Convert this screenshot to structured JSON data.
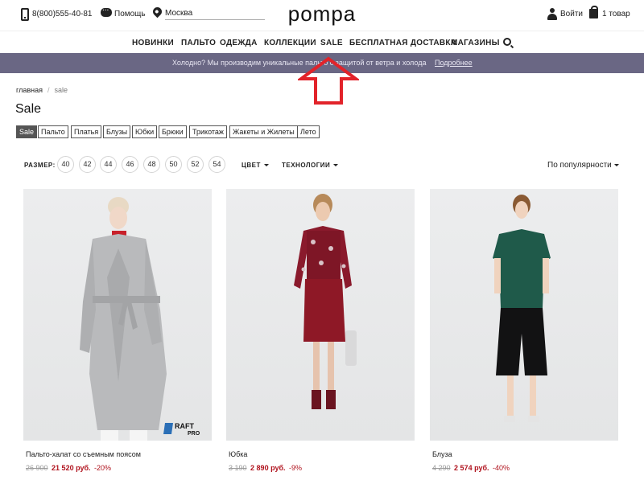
{
  "header": {
    "phone": "8(800)555-40-81",
    "help": "Помощь",
    "city": "Москва",
    "logo": "pompa",
    "login": "Войти",
    "cart": "1 товар"
  },
  "nav": {
    "items": [
      "НОВИНКИ",
      "ПАЛЬТО",
      "ОДЕЖДА",
      "КОЛЛЕКЦИИ",
      "SALE",
      "БЕСПЛАТНАЯ ДОСТАВКА",
      "МАГАЗИНЫ"
    ]
  },
  "promo": {
    "text": "Холодно? Мы производим уникальные пальто с защитой от ветра и холода",
    "link": "Подробнее",
    "color": "#6a6784"
  },
  "breadcrumb": {
    "home": "главная",
    "sep": "/",
    "current": "sale"
  },
  "page": {
    "title": "Sale"
  },
  "categories": [
    "Sale",
    "Пальто",
    "Платья",
    "Блузы",
    "Юбки",
    "Брюки",
    "Трикотаж",
    "Жакеты и Жилеты",
    "Лето"
  ],
  "filters": {
    "size_label": "РАЗМЕР:",
    "sizes": [
      "40",
      "42",
      "44",
      "46",
      "48",
      "50",
      "52",
      "54"
    ],
    "color": "ЦВЕТ",
    "tech": "ТЕХНОЛОГИИ",
    "sort": "По популярности"
  },
  "products": [
    {
      "name": "Пальто-халат со съемным поясом",
      "old_price": "26 900",
      "new_price": "21 520 руб.",
      "discount": "-20%",
      "badge": "RAFT PRO"
    },
    {
      "name": "Юбка",
      "old_price": "3 190",
      "new_price": "2 890 руб.",
      "discount": "-9%"
    },
    {
      "name": "Блуза",
      "old_price": "4 290",
      "new_price": "2 574 руб.",
      "discount": "-40%"
    }
  ],
  "colors": {
    "accent_red": "#b0121d",
    "promo_bg": "#6a6784",
    "arrow_red": "#e2232a"
  }
}
